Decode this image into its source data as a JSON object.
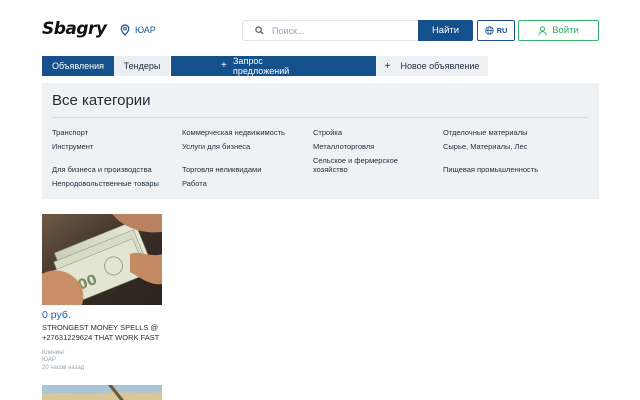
{
  "header": {
    "logo": "Sbagry",
    "location": "ЮАР",
    "search_placeholder": "Поиск...",
    "find_label": "Найти",
    "lang_label": "RU",
    "login_label": "Войти"
  },
  "tabs": {
    "ads": "Объявления",
    "tenders": "Тендеры",
    "request": "Запрос предложений",
    "new_ad": "Новое объявление"
  },
  "categories": {
    "title": "Все категории",
    "items": [
      "Транспорт",
      "Коммерческая недвижимость",
      "Стройка",
      "Отделочные материалы",
      "Инструмент",
      "Услуги для бизнеса",
      "Металлоторговля",
      "Сырье, Материалы, Лес",
      "Для бизнеса и производства",
      "Торговля неликвидами",
      "Сельское и фермерское хозяйство",
      "Пищевая промышленность",
      "Непродовольственные товары",
      "Работа"
    ]
  },
  "listing": {
    "price": "0 руб.",
    "title": "STRONGEST MONEY SPELLS @ +27631229624 THAT WORK FAST",
    "category": "Клининг",
    "location": "ЮАР",
    "time": "20 часов назад"
  },
  "colors": {
    "primary": "#14508c",
    "accent_green": "#35b36b",
    "panel_bg": "#eef2f5",
    "price": "#1c5fa8"
  }
}
